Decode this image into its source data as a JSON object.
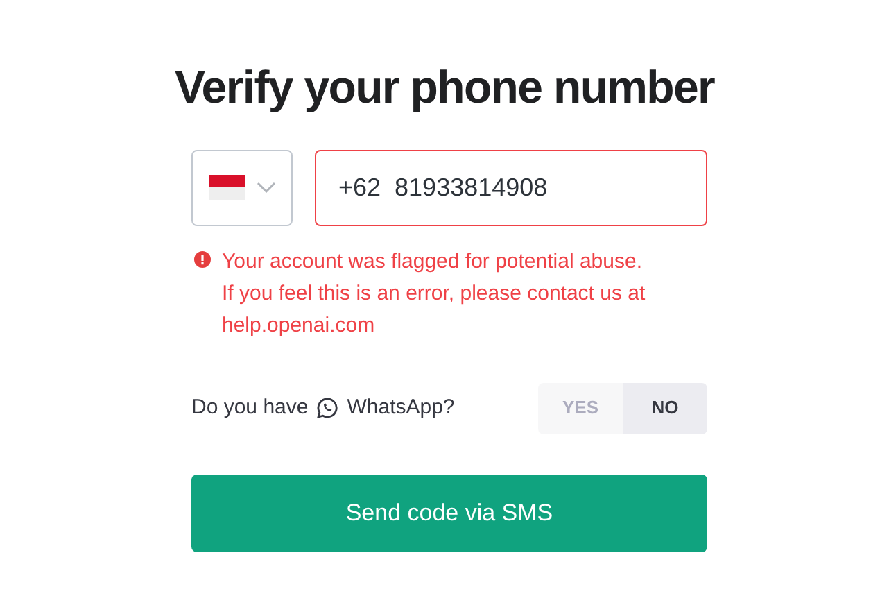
{
  "title": "Verify your phone number",
  "country_select": {
    "expanded": false
  },
  "phone_field": {
    "value": "+62  81933814908",
    "invalid": true
  },
  "error": {
    "lines": [
      "Your account was flagged for potential abuse.",
      "If you feel this is an error, please contact us at",
      "help.openai.com"
    ]
  },
  "whatsapp": {
    "prefix": "Do you have",
    "app": "WhatsApp?",
    "options": [
      {
        "label": "YES",
        "selected": false
      },
      {
        "label": "NO",
        "selected": true
      }
    ]
  },
  "submit": {
    "label": "Send code via SMS"
  }
}
